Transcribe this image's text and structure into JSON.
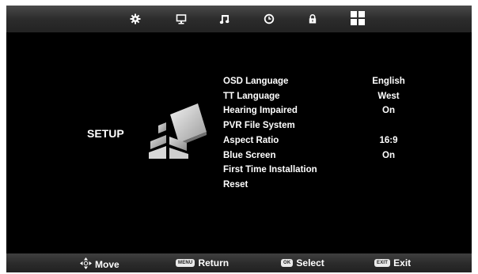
{
  "top_tabs": [
    {
      "name": "settings-gear-icon"
    },
    {
      "name": "monitor-icon"
    },
    {
      "name": "music-note-icon"
    },
    {
      "name": "clock-icon"
    },
    {
      "name": "lock-icon"
    },
    {
      "name": "setup-grid-icon"
    }
  ],
  "page": {
    "title": "SETUP"
  },
  "menu": [
    {
      "label": "OSD Language",
      "value": "English"
    },
    {
      "label": "TT Language",
      "value": "West"
    },
    {
      "label": "Hearing Impaired",
      "value": "On"
    },
    {
      "label": "PVR File System",
      "value": ""
    },
    {
      "label": "Aspect Ratio",
      "value": "16:9"
    },
    {
      "label": "Blue Screen",
      "value": "On"
    },
    {
      "label": "First Time Installation",
      "value": ""
    },
    {
      "label": "Reset",
      "value": ""
    }
  ],
  "footer": {
    "move_label": "Move",
    "menu_key": "MENU",
    "return_label": "Return",
    "ok_key": "OK",
    "select_label": "Select",
    "exit_key": "EXIT",
    "exit_label": "Exit"
  },
  "colors": {
    "background": "#000000",
    "text": "#ffffff",
    "bar": "#333333"
  }
}
